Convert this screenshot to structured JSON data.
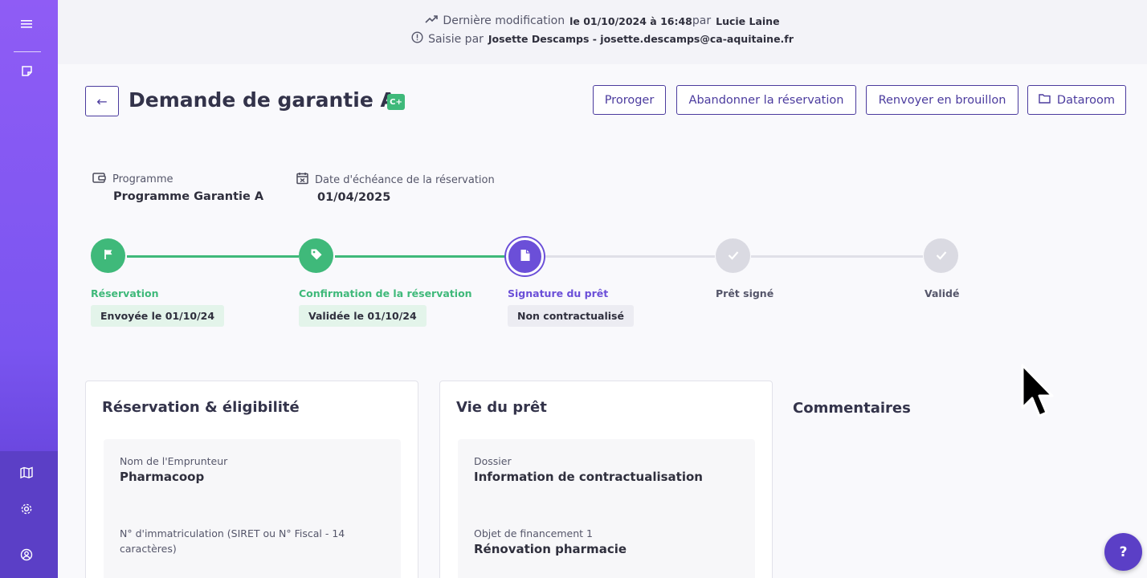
{
  "sidebar": {
    "top_icons": [
      "menu-icon",
      "notes-icon"
    ],
    "bottom_icons": [
      "map-book-icon",
      "settings-gear-icon",
      "user-account-icon"
    ]
  },
  "topbar": {
    "modified_label": "Dernière modification",
    "modified_date": "le 01/10/2024 à 16:48",
    "modified_by_prefix": "par",
    "modified_by": "Lucie Laine",
    "entered_label": "Saisie par",
    "entered_by": "Josette Descamps - josette.descamps@ca-aquitaine.fr"
  },
  "header": {
    "back_label": "←",
    "title": "Demande de garantie A",
    "badge": "C+",
    "buttons": {
      "proroger": "Proroger",
      "abandon": "Abandonner la réservation",
      "draft": "Renvoyer en brouillon",
      "dataroom": "Dataroom"
    }
  },
  "info": {
    "programme_label": "Programme",
    "programme_value": "Programme Garantie A",
    "deadline_label": "Date d'échéance de la réservation",
    "deadline_value": "01/04/2025"
  },
  "stepper": {
    "steps": [
      {
        "label": "Réservation",
        "status": "Envoyée le 01/10/24",
        "state": "done"
      },
      {
        "label": "Confirmation de la réservation",
        "status": "Validée le 01/10/24",
        "state": "done"
      },
      {
        "label": "Signature du prêt",
        "status": "Non contractualisé",
        "state": "current"
      },
      {
        "label": "Prêt signé",
        "status": "",
        "state": "todo"
      },
      {
        "label": "Validé",
        "status": "",
        "state": "todo"
      }
    ]
  },
  "cards": {
    "eligibility": {
      "title": "Réservation & éligibilité",
      "field1_label": "Nom de l'Emprunteur",
      "field1_value": "Pharmacoop",
      "field2_label_line1": "N° d'immatriculation (SIRET ou N° Fiscal - 14",
      "field2_label_line2": "caractères)"
    },
    "loan_life": {
      "title": "Vie du prêt",
      "field1_label": "Dossier",
      "field1_value": "Information de contractualisation",
      "field2_label": "Objet de financement 1",
      "field2_value": "Rénovation pharmacie"
    },
    "comments_title": "Commentaires"
  },
  "help": {
    "label": "?"
  },
  "colors": {
    "primary": "#4b3b9e",
    "sidebar": "#8f5cf5",
    "success": "#3fb97a",
    "current_step": "#6b4fd8",
    "todo_step": "#d8d8e0"
  }
}
